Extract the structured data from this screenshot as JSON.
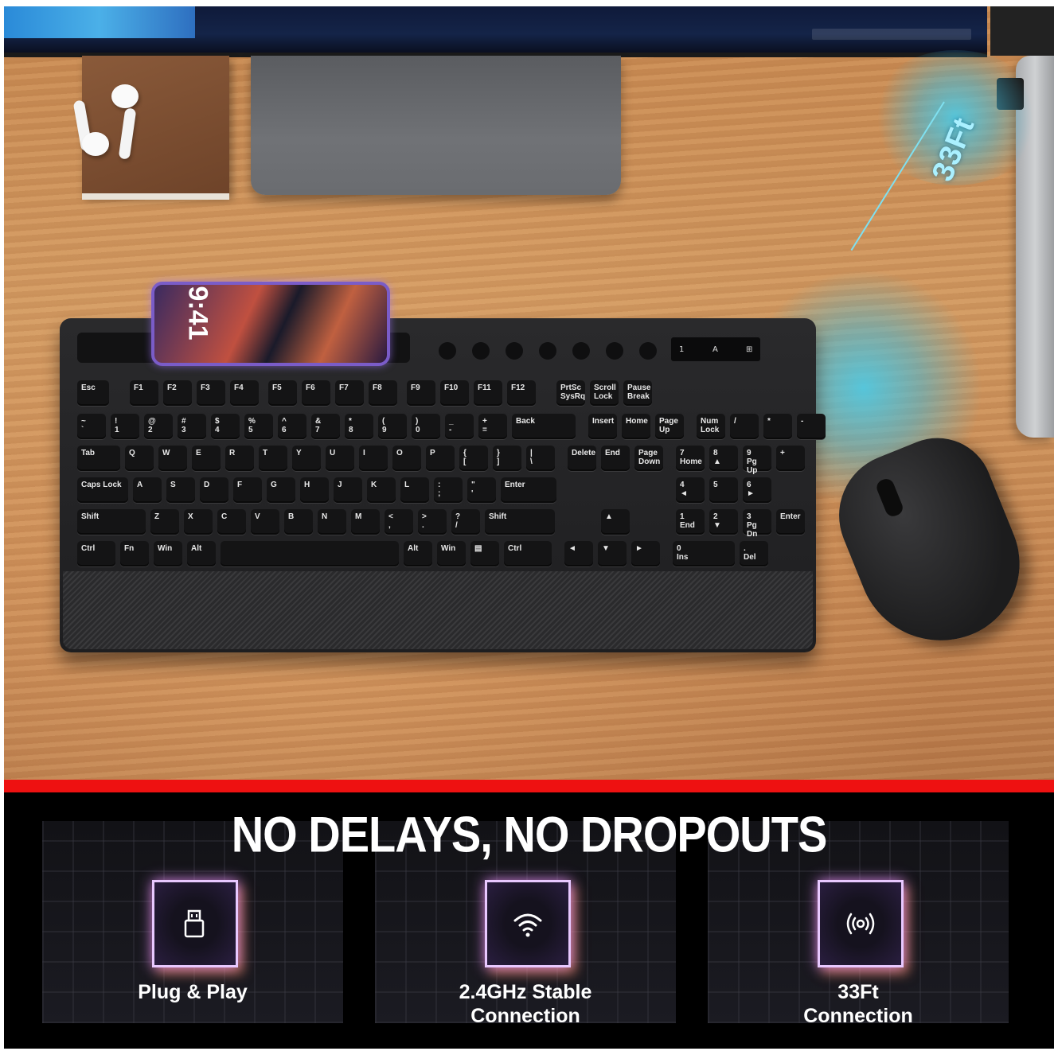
{
  "photo": {
    "phone_time": "9:41",
    "range_label": "33Ft",
    "keyboard": {
      "function_row": [
        "Esc",
        "F1",
        "F2",
        "F3",
        "F4",
        "F5",
        "F6",
        "F7",
        "F8",
        "F9",
        "F10",
        "F11",
        "F12",
        "PrtSc\nSysRq",
        "Scroll\nLock",
        "Pause\nBreak"
      ],
      "number_row": [
        "~\n`",
        "!\n1",
        "@\n2",
        "#\n3",
        "$\n4",
        "%\n5",
        "^\n6",
        "&\n7",
        "*\n8",
        "(\n9",
        ")\n0",
        "_\n-",
        "+\n=",
        "Back",
        "Insert",
        "Home",
        "Page\nUp",
        "Num\nLock",
        "/",
        "*",
        "-"
      ],
      "tab_row": [
        "Tab",
        "Q",
        "W",
        "E",
        "R",
        "T",
        "Y",
        "U",
        "I",
        "O",
        "P",
        "{\n[",
        "}\n]",
        "|\n\\",
        "Delete",
        "End",
        "Page\nDown",
        "7\nHome",
        "8\n▲",
        "9\nPg Up",
        "+"
      ],
      "caps_row": [
        "Caps Lock",
        "A",
        "S",
        "D",
        "F",
        "G",
        "H",
        "J",
        "K",
        "L",
        ":\n;",
        "\"\n'",
        "Enter",
        "4\n◄",
        "5",
        "6\n►"
      ],
      "shift_row": [
        "Shift",
        "Z",
        "X",
        "C",
        "V",
        "B",
        "N",
        "M",
        "<\n,",
        ">\n.",
        "?\n/",
        "Shift",
        "▲",
        "1\nEnd",
        "2\n▼",
        "3\nPg Dn",
        "Enter"
      ],
      "bottom_row": [
        "Ctrl",
        "Fn",
        "Win",
        "Alt",
        "",
        "Alt",
        "Win",
        "▤",
        "Ctrl",
        "◄",
        "▼",
        "►",
        "0\nIns",
        ".\nDel"
      ],
      "indicators": [
        "1",
        "A",
        "⊞"
      ]
    }
  },
  "banner": {
    "title": "NO DELAYS, NO DROPOUTS",
    "accent_color": "#e11111",
    "features": [
      {
        "icon": "usb-receiver-icon",
        "label_line1": "Plug & Play",
        "label_line2": ""
      },
      {
        "icon": "wifi-icon",
        "label_line1": "2.4GHz Stable",
        "label_line2": "Connection"
      },
      {
        "icon": "wireless-signal-icon",
        "label_line1": "33Ft",
        "label_line2": "Connection"
      }
    ]
  }
}
